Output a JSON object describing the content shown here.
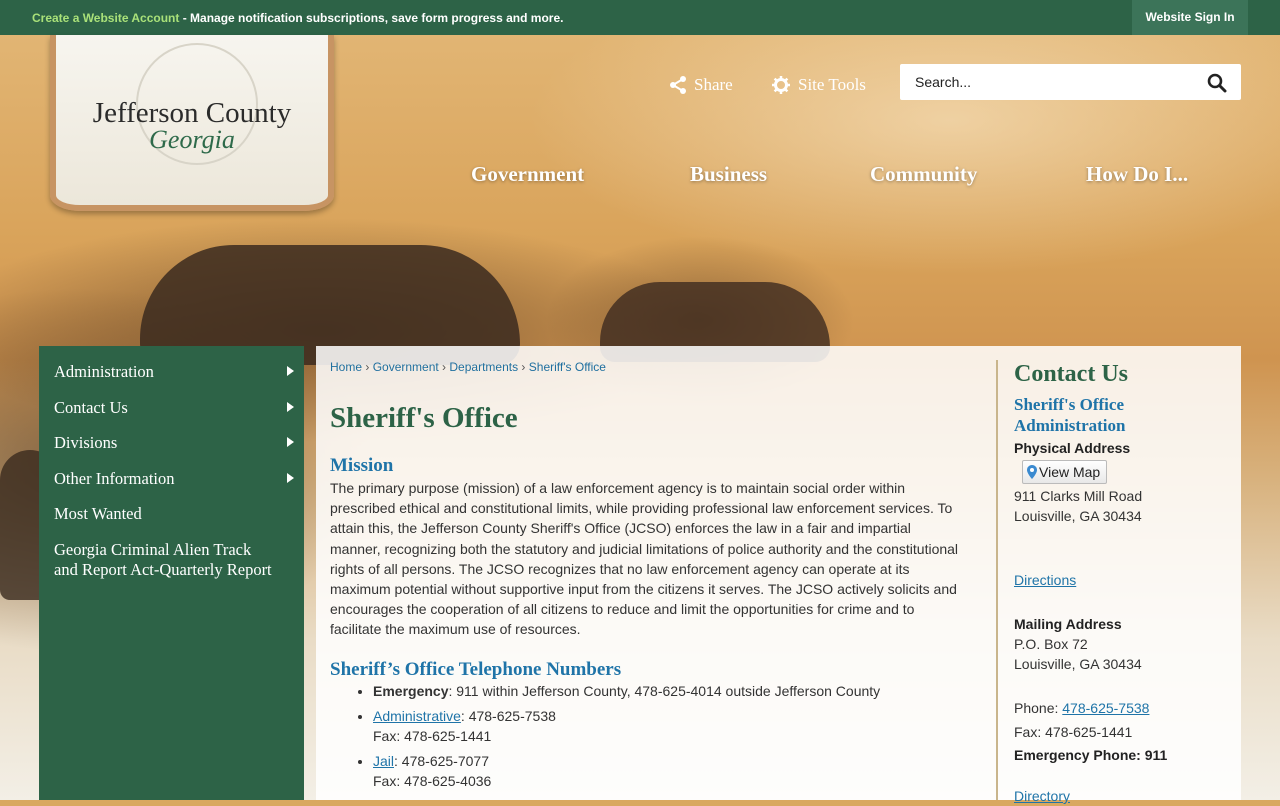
{
  "topbar": {
    "create_account_link": "Create a Website Account",
    "create_account_text": " - Manage notification subscriptions, save form progress and more.",
    "sign_in": "Website Sign In"
  },
  "logo": {
    "name": "Jefferson County",
    "state": "Georgia"
  },
  "tools": {
    "share": "Share",
    "site_tools": "Site Tools"
  },
  "search": {
    "placeholder": "Search..."
  },
  "main_nav": [
    "Government",
    "Business",
    "Community",
    "How Do I..."
  ],
  "sidebar": {
    "items": [
      {
        "label": "Administration"
      },
      {
        "label": "Contact Us"
      },
      {
        "label": "Divisions"
      },
      {
        "label": "Other Information"
      },
      {
        "label": "Most Wanted"
      },
      {
        "label": "Georgia Criminal Alien Track and Report Act-Quarterly Report"
      }
    ]
  },
  "breadcrumb": [
    "Home",
    "Government",
    "Departments",
    "Sheriff's Office"
  ],
  "page": {
    "title": "Sheriff's Office",
    "mission_heading": "Mission",
    "mission_text": "The primary purpose (mission) of a law enforcement agency is to maintain social order within prescribed ethical and constitutional limits, while providing professional law enforcement services. To attain this, the Jefferson County Sheriff's Office (JCSO) enforces the law in a fair and impartial manner, recognizing both the statutory and judicial limitations of police authority and the constitutional rights of all persons. The JCSO recognizes that no law enforcement agency can operate at its maximum potential without supportive input from the citizens it serves. The JCSO actively solicits and encourages the cooperation of all citizens to reduce and limit the opportunities for crime and to facilitate the maximum use of resources.",
    "phones_heading": "Sheriff’s Office Telephone Numbers",
    "phones": {
      "emergency_label": "Emergency",
      "emergency_text": ": 911 within Jefferson County, 478-625-4014 outside Jefferson County",
      "admin_link": "Administrative",
      "admin_text": ": 478-625-7538",
      "admin_fax": "Fax: 478-625-1441",
      "jail_link": "Jail",
      "jail_text": ": 478-625-7077",
      "jail_fax": "Fax: 478-625-4036"
    }
  },
  "contact": {
    "heading": "Contact Us",
    "dept_name": "Sheriff's Office Administration",
    "physical_label": "Physical Address",
    "view_map": "View Map",
    "street": "911 Clarks Mill Road",
    "city": "Louisville, GA 30434",
    "directions": "Directions",
    "mailing_label": "Mailing Address",
    "po_box": "P.O. Box 72",
    "mail_city": "Louisville, GA 30434",
    "phone_label": "Phone: ",
    "phone": "478-625-7538",
    "fax": "Fax: 478-625-1441",
    "emergency": "Emergency Phone: 911",
    "directory": "Directory"
  }
}
